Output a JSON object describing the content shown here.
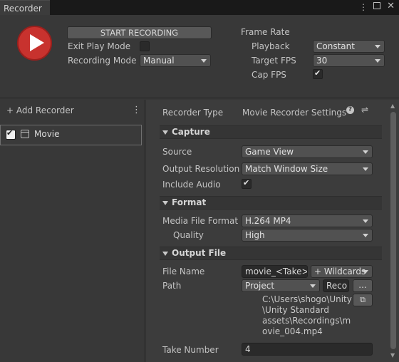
{
  "window": {
    "tab_title": "Recorder",
    "menu_icon": "kebab-menu-icon",
    "maximize_icon": "maximize-icon",
    "close_icon": "close-icon"
  },
  "controls": {
    "start_label": "START RECORDING",
    "exit_play_mode_label": "Exit Play Mode",
    "exit_play_mode_checked": false,
    "recording_mode_label": "Recording Mode",
    "recording_mode_value": "Manual"
  },
  "frame_rate": {
    "title": "Frame Rate",
    "playback_label": "Playback",
    "playback_value": "Constant",
    "target_fps_label": "Target FPS",
    "target_fps_value": "30",
    "cap_fps_label": "Cap FPS",
    "cap_fps_checked": true
  },
  "recorder_list": {
    "add_label": "+ Add Recorder",
    "items": [
      {
        "label": "Movie",
        "enabled": true,
        "selected": true
      }
    ]
  },
  "settings": {
    "recorder_type_label": "Recorder Type",
    "recorder_type_value": "Movie Recorder Settings",
    "capture": {
      "header": "Capture",
      "source_label": "Source",
      "source_value": "Game View",
      "resolution_label": "Output Resolution",
      "resolution_value": "Match Window Size",
      "audio_label": "Include Audio",
      "audio_checked": true
    },
    "format": {
      "header": "Format",
      "media_label": "Media File Format",
      "media_value": "H.264 MP4",
      "quality_label": "Quality",
      "quality_value": "High"
    },
    "output": {
      "header": "Output File",
      "file_name_label": "File Name",
      "file_name_value": "movie_<Take>",
      "wildcards_label": "+ Wildcards",
      "path_label": "Path",
      "path_root_value": "Project",
      "path_field_value": "Reco",
      "browse_label": "...",
      "full_path_line1": "C:\\Users\\shogo\\Unity",
      "full_path_line2": "\\Unity Standard",
      "full_path_line3": "assets\\Recordings\\m",
      "full_path_line4": "ovie_004.mp4",
      "take_label": "Take Number",
      "take_value": "4"
    }
  },
  "colors": {
    "record_red": "#c8322e",
    "background": "#383838",
    "panel": "#3c3c3c"
  }
}
